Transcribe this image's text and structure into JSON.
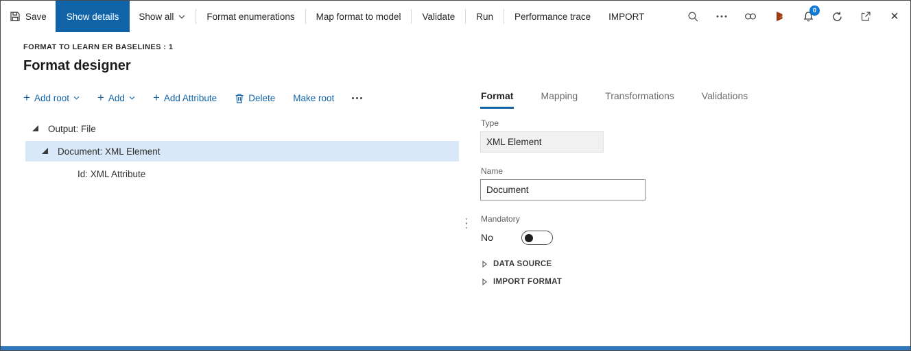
{
  "colors": {
    "accent": "#1163A8",
    "selection": "#D8E8F8",
    "badge": "#0F7BD4",
    "bottombar": "#3179BE",
    "logo": "#9C3C10"
  },
  "icons": {
    "plus": "+",
    "close": "×"
  },
  "toolbar": {
    "save_label": "Save",
    "show_details_label": "Show details",
    "show_all_label": "Show all",
    "format_enumerations_label": "Format enumerations",
    "map_format_to_model_label": "Map format to model",
    "validate_label": "Validate",
    "run_label": "Run",
    "performance_trace_label": "Performance trace",
    "import_label": "IMPORT",
    "notification_count": "0"
  },
  "header": {
    "breadcrumb": "FORMAT TO LEARN ER BASELINES : 1",
    "title": "Format designer"
  },
  "designer_toolbar": {
    "add_root_label": "Add root",
    "add_label": "Add",
    "add_attribute_label": "Add Attribute",
    "delete_label": "Delete",
    "make_root_label": "Make root"
  },
  "tree": {
    "items": [
      {
        "label": "Output: File",
        "level": 0,
        "expanded": true,
        "selected": false
      },
      {
        "label": "Document: XML Element",
        "level": 1,
        "expanded": true,
        "selected": true
      },
      {
        "label": "Id: XML Attribute",
        "level": 2,
        "expanded": false,
        "selected": false
      }
    ]
  },
  "detail": {
    "tabs": [
      "Format",
      "Mapping",
      "Transformations",
      "Validations"
    ],
    "active_tab": "Format",
    "fields": {
      "type": {
        "label": "Type",
        "value": "XML Element",
        "readonly": true
      },
      "name": {
        "label": "Name",
        "value": "Document",
        "readonly": false
      },
      "mandatory": {
        "label": "Mandatory",
        "value": "No",
        "toggle_on": false
      }
    },
    "sections": [
      {
        "label": "DATA SOURCE",
        "expanded": false
      },
      {
        "label": "IMPORT FORMAT",
        "expanded": false
      }
    ]
  }
}
